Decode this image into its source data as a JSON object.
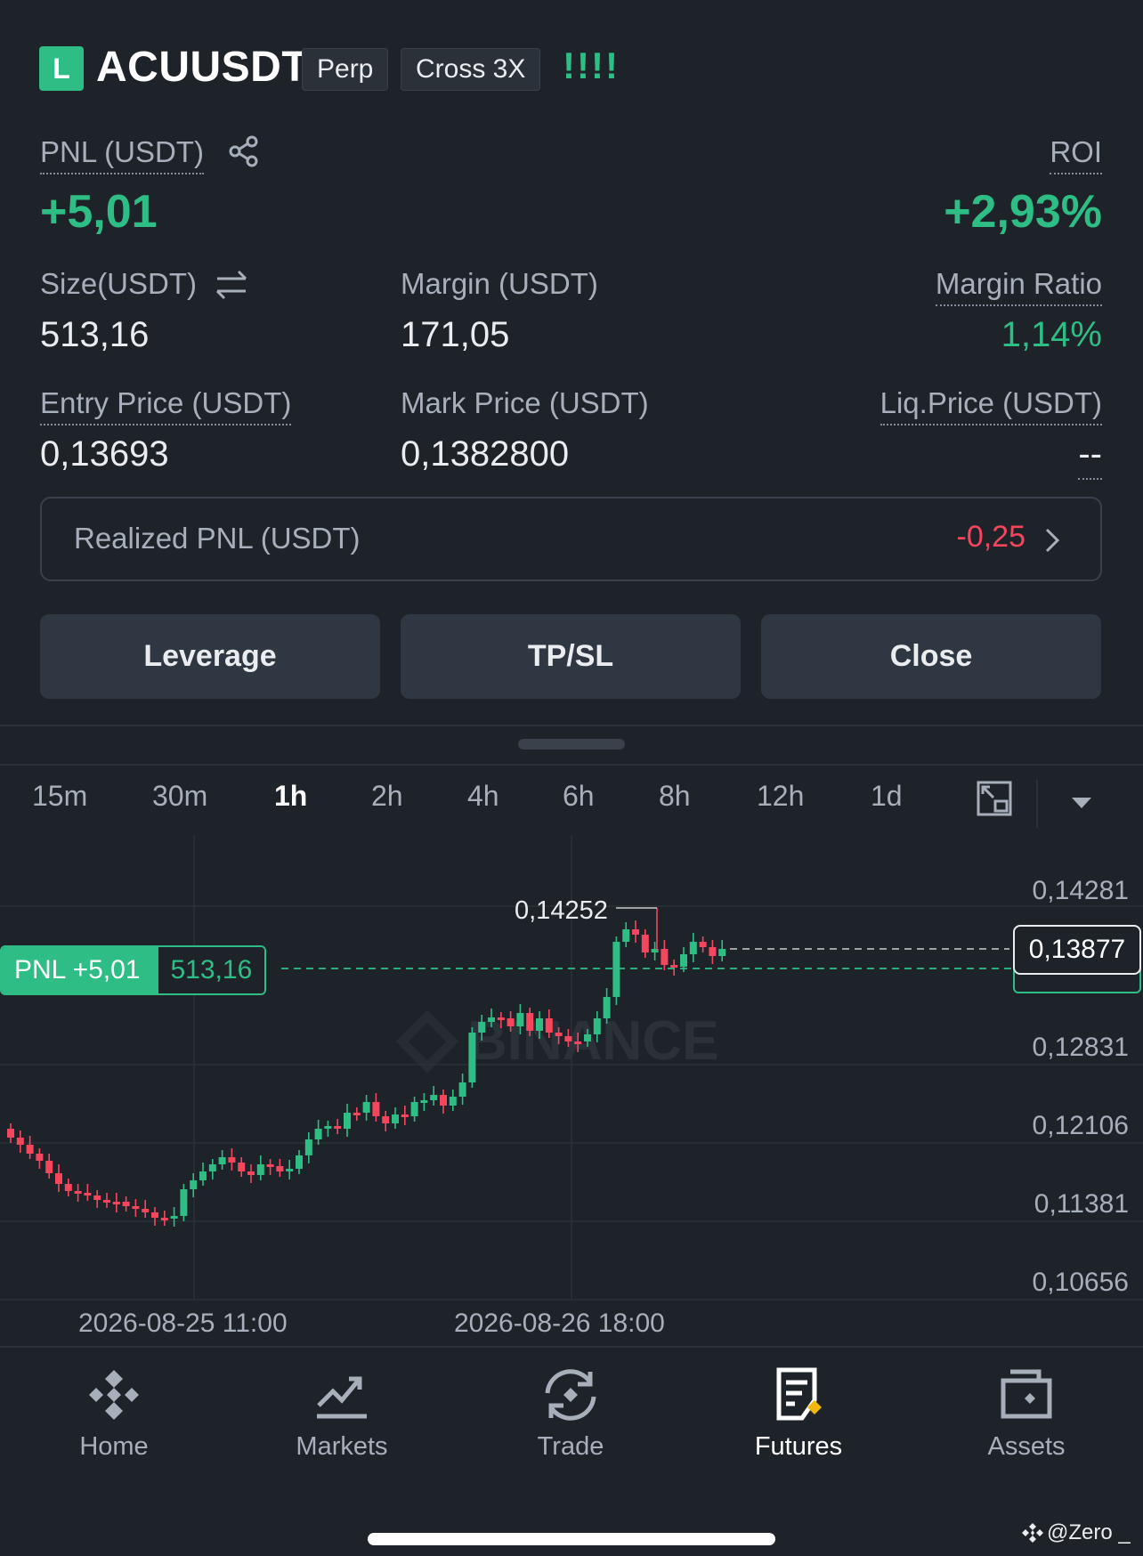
{
  "header": {
    "side_badge": "L",
    "symbol": "ACUUSDT",
    "tag_type": "Perp",
    "tag_margin": "Cross 3X",
    "signal": "!!!!"
  },
  "pnl": {
    "label": "PNL (USDT)",
    "value": "+5,01"
  },
  "roi": {
    "label": "ROI",
    "value": "+2,93%"
  },
  "size": {
    "label": "Size(USDT)",
    "value": "513,16"
  },
  "margin": {
    "label": "Margin (USDT)",
    "value": "171,05"
  },
  "margin_ratio": {
    "label": "Margin Ratio",
    "value": "1,14%"
  },
  "entry_price": {
    "label": "Entry Price (USDT)",
    "value": "0,13693"
  },
  "mark_price": {
    "label": "Mark Price (USDT)",
    "value": "0,1382800"
  },
  "liq_price": {
    "label": "Liq.Price (USDT)",
    "value": "--"
  },
  "realized": {
    "label": "Realized PNL (USDT)",
    "value": "-0,25"
  },
  "actions": {
    "leverage": "Leverage",
    "tpsl": "TP/SL",
    "close": "Close"
  },
  "timeframes": [
    "15m",
    "30m",
    "1h",
    "2h",
    "4h",
    "6h",
    "8h",
    "12h",
    "1d"
  ],
  "active_timeframe": "1h",
  "chart": {
    "watermark": "BINANCE",
    "high_label": "0,14252",
    "current_price": "0,13877",
    "pnl_tag": "PNL +5,01",
    "pnl_size": "513,16",
    "y_ticks": [
      "0,14281",
      "0,12831",
      "0,12106",
      "0,11381",
      "0,10656"
    ],
    "x_ticks": [
      "2026-08-25 11:00",
      "2026-08-26 18:00"
    ]
  },
  "nav": [
    {
      "label": "Home",
      "icon": "binance-logo-icon"
    },
    {
      "label": "Markets",
      "icon": "markets-chart-icon"
    },
    {
      "label": "Trade",
      "icon": "trade-swap-icon"
    },
    {
      "label": "Futures",
      "icon": "futures-document-icon"
    },
    {
      "label": "Assets",
      "icon": "wallet-icon"
    }
  ],
  "active_nav": "Futures",
  "watermark_user": "@Zero _",
  "colors": {
    "up": "#2ebd85",
    "down": "#f6465d",
    "bg": "#1e2329"
  }
}
